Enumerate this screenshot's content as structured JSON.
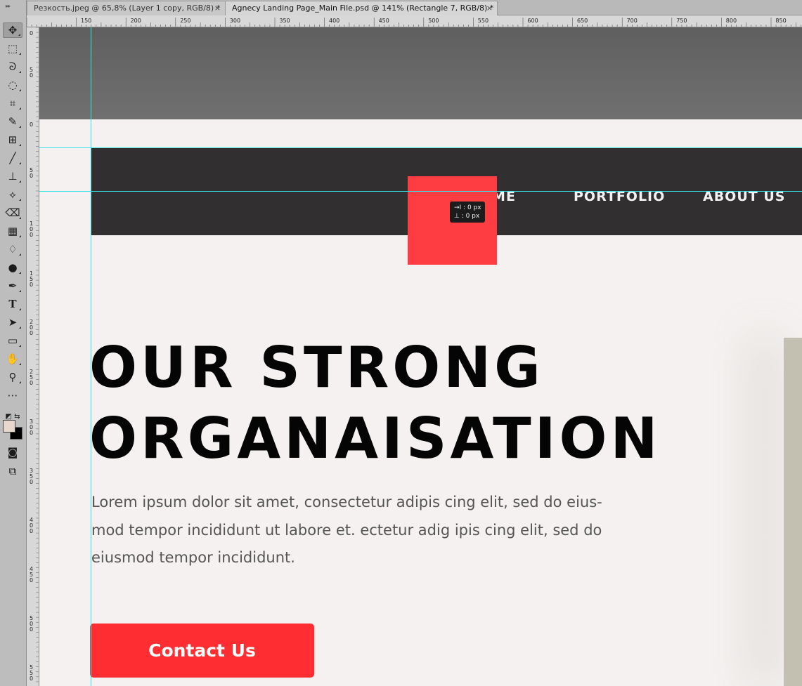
{
  "tabs": [
    {
      "label": "Резкость.jpeg @ 65,8% (Layer 1 copy, RGB/8) *",
      "close": "×",
      "active": false
    },
    {
      "label": "Agnecy Landing Page_Main File.psd @ 141% (Rectangle 7, RGB/8) *",
      "close": "×",
      "active": true
    }
  ],
  "toolbar": {
    "icons": [
      "move-tool-icon",
      "marquee-tool-icon",
      "lasso-tool-icon",
      "quick-select-tool-icon",
      "crop-tool-icon",
      "eyedropper-tool-icon",
      "frame-tool-icon",
      "brush-tool-icon",
      "stamp-tool-icon",
      "history-brush-tool-icon",
      "eraser-tool-icon",
      "gradient-tool-icon",
      "blur-tool-icon",
      "dodge-tool-icon",
      "pen-tool-icon",
      "type-tool-icon",
      "path-select-tool-icon",
      "rectangle-tool-icon",
      "hand-tool-icon",
      "zoom-tool-icon",
      "more-tools-icon"
    ],
    "glyphs": [
      "✥",
      "⬚",
      "ᘐ",
      "◌",
      "⌗",
      "✎",
      "⊞",
      "╱",
      "⊥",
      "⟡",
      "⌫",
      "▦",
      "♢",
      "●",
      "✒",
      "T",
      "➤",
      "▭",
      "✋",
      "⚲",
      "⋯"
    ],
    "type_glyph": "T",
    "foreground_color": "#e7d7cf",
    "background_color": "#000000"
  },
  "ruler_top": {
    "labels": [
      "150",
      "200",
      "250",
      "300",
      "350",
      "400",
      "450",
      "500",
      "550",
      "600",
      "650",
      "700",
      "750",
      "800",
      "850"
    ]
  },
  "ruler_left": {
    "labels": [
      "0",
      "5 0",
      "0",
      "5 0",
      "1 0 0",
      "1 5 0",
      "2 0 0",
      "2 5 0",
      "3 0 0",
      "3 5 0",
      "4 0 0",
      "4 5 0",
      "5 0 0",
      "5 5 0"
    ]
  },
  "page": {
    "colors": {
      "accent": "#fd3d41",
      "button": "#fe2d31",
      "nav_bg": "#312f30",
      "page_bg": "#f4f1f0",
      "guide": "#35e2e8"
    },
    "nav": [
      "HOME",
      "PORTFOLIO",
      "ABOUT US"
    ],
    "tooltip": {
      "line1": "→I : 0 px",
      "line2": "⊥ : 0 px"
    },
    "headline": [
      "OUR STRONG",
      "ORGANAISATION"
    ],
    "paragraph_lines": [
      "Lorem ipsum dolor sit amet, consectetur adipis cing elit, sed do eius-",
      "mod tempor incididunt  ut labore et. ectetur adig ipis cing elit, sed do",
      "eiusmod tempor incididunt."
    ],
    "cta": "Contact Us"
  }
}
